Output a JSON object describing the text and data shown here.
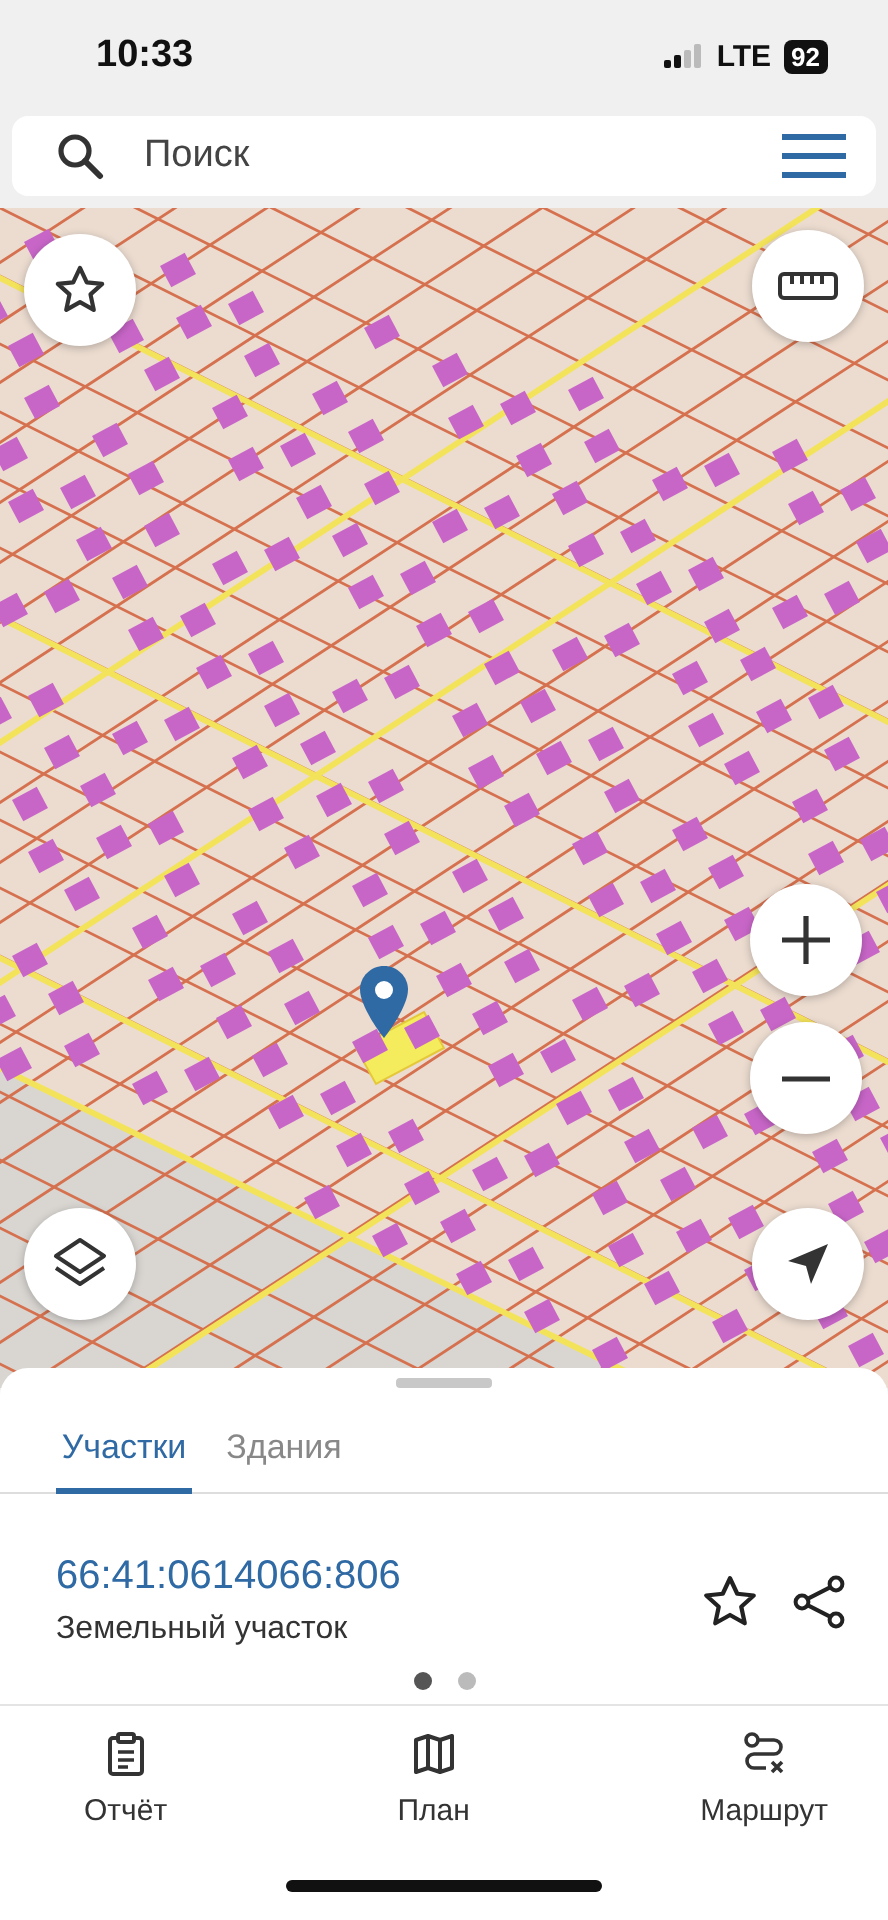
{
  "status_bar": {
    "time": "10:33",
    "network": "LTE",
    "battery": "92"
  },
  "search": {
    "placeholder": "Поиск"
  },
  "tabs": [
    {
      "label": "Участки",
      "selected": true
    },
    {
      "label": "Здания",
      "selected": false
    }
  ],
  "parcel": {
    "number": "66:41:0614066:806",
    "type": "Земельный участок"
  },
  "page_dots": [
    {
      "selected": true
    },
    {
      "selected": false
    }
  ],
  "bottom_nav": [
    {
      "label": "Отчёт",
      "kind": "report"
    },
    {
      "label": "План",
      "kind": "map"
    },
    {
      "label": "Маршрут",
      "kind": "route"
    }
  ]
}
